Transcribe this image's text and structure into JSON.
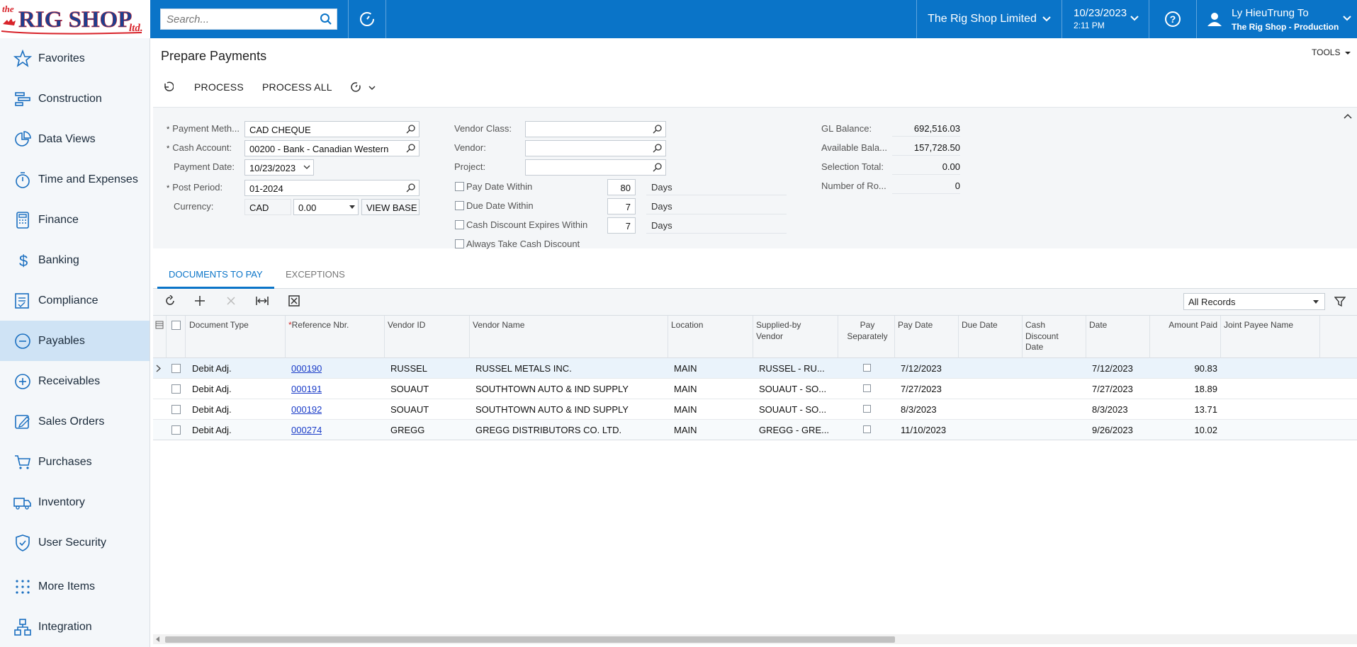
{
  "topbar": {
    "logo_prefix": "the",
    "logo_main": "RIG SHOP",
    "logo_suffix": "ltd.",
    "search_placeholder": "Search...",
    "company": "The Rig Shop Limited",
    "date": "10/23/2023",
    "time": "2:11 PM",
    "user_name": "Ly HieuTrung To",
    "user_tenant": "The Rig Shop - Production",
    "accent": "#0a74c8"
  },
  "sidebar": {
    "items": [
      {
        "label": "Favorites",
        "icon": "star-icon"
      },
      {
        "label": "Construction",
        "icon": "construction-icon"
      },
      {
        "label": "Data Views",
        "icon": "pie-chart-icon"
      },
      {
        "label": "Time and Expenses",
        "icon": "stopwatch-icon"
      },
      {
        "label": "Finance",
        "icon": "calculator-icon"
      },
      {
        "label": "Banking",
        "icon": "dollar-icon"
      },
      {
        "label": "Compliance",
        "icon": "checklist-icon"
      },
      {
        "label": "Payables",
        "icon": "minus-circle-icon"
      },
      {
        "label": "Receivables",
        "icon": "plus-circle-icon"
      },
      {
        "label": "Sales Orders",
        "icon": "pencil-icon"
      },
      {
        "label": "Purchases",
        "icon": "cart-icon"
      },
      {
        "label": "Inventory",
        "icon": "truck-icon"
      },
      {
        "label": "User Security",
        "icon": "shield-icon"
      },
      {
        "label": "More Items",
        "icon": "dots-grid-icon"
      },
      {
        "label": "Integration",
        "icon": "integration-icon"
      }
    ]
  },
  "page": {
    "title": "Prepare Payments",
    "tools": "TOOLS",
    "process": "PROCESS",
    "process_all": "PROCESS ALL"
  },
  "form": {
    "payment_method_label": "Payment Meth...",
    "payment_method": "CAD CHEQUE",
    "cash_account_label": "Cash Account:",
    "cash_account": "00200 - Bank - Canadian Western",
    "payment_date_label": "Payment Date:",
    "payment_date": "10/23/2023",
    "post_period_label": "Post Period:",
    "post_period": "01-2024",
    "currency_label": "Currency:",
    "currency": "CAD",
    "currency_rate": "0.00",
    "view_base": "VIEW BASE",
    "vendor_class_label": "Vendor Class:",
    "vendor_label": "Vendor:",
    "project_label": "Project:",
    "pay_date_within_label": "Pay Date Within",
    "pay_date_within": "80",
    "due_date_within_label": "Due Date Within",
    "due_date_within": "7",
    "cash_discount_label": "Cash Discount Expires Within",
    "cash_discount_within": "7",
    "days": "Days",
    "always_take_label": "Always Take Cash Discount",
    "gl_balance_label": "GL Balance:",
    "gl_balance": "692,516.03",
    "available_label": "Available Bala...",
    "available": "157,728.50",
    "selection_total_label": "Selection Total:",
    "selection_total": "0.00",
    "num_rows_label": "Number of Ro...",
    "num_rows": "0"
  },
  "tabs": {
    "documents": "DOCUMENTS TO PAY",
    "exceptions": "EXCEPTIONS"
  },
  "grid": {
    "filter": "All Records",
    "headers": {
      "doc_type": "Document Type",
      "ref_nbr": "Reference Nbr.",
      "vendor_id": "Vendor ID",
      "vendor_name": "Vendor Name",
      "location": "Location",
      "supplied_1": "Supplied-by",
      "supplied_2": "Vendor",
      "pay_sep_1": "Pay",
      "pay_sep_2": "Separately",
      "pay_date": "Pay Date",
      "due_date": "Due Date",
      "cash_1": "Cash",
      "cash_2": "Discount",
      "cash_3": "Date",
      "date": "Date",
      "amount_paid": "Amount Paid",
      "joint_payee": "Joint Payee Name"
    },
    "rows": [
      {
        "doc_type": "Debit Adj.",
        "ref_nbr": "000190",
        "vendor_id": "RUSSEL",
        "vendor_name": "RUSSEL METALS INC.",
        "location": "MAIN",
        "supplied": "RUSSEL - RU...",
        "pay_date": "7/12/2023",
        "date": "7/12/2023",
        "amount": "90.83"
      },
      {
        "doc_type": "Debit Adj.",
        "ref_nbr": "000191",
        "vendor_id": "SOUAUT",
        "vendor_name": "SOUTHTOWN AUTO & IND SUPPLY",
        "location": "MAIN",
        "supplied": "SOUAUT - SO...",
        "pay_date": "7/27/2023",
        "date": "7/27/2023",
        "amount": "18.89"
      },
      {
        "doc_type": "Debit Adj.",
        "ref_nbr": "000192",
        "vendor_id": "SOUAUT",
        "vendor_name": "SOUTHTOWN AUTO & IND SUPPLY",
        "location": "MAIN",
        "supplied": "SOUAUT - SO...",
        "pay_date": "8/3/2023",
        "date": "8/3/2023",
        "amount": "13.71"
      },
      {
        "doc_type": "Debit Adj.",
        "ref_nbr": "000274",
        "vendor_id": "GREGG",
        "vendor_name": "GREGG DISTRIBUTORS CO. LTD.",
        "location": "MAIN",
        "supplied": "GREGG - GRE...",
        "pay_date": "11/10/2023",
        "date": "9/26/2023",
        "amount": "10.02"
      }
    ]
  }
}
